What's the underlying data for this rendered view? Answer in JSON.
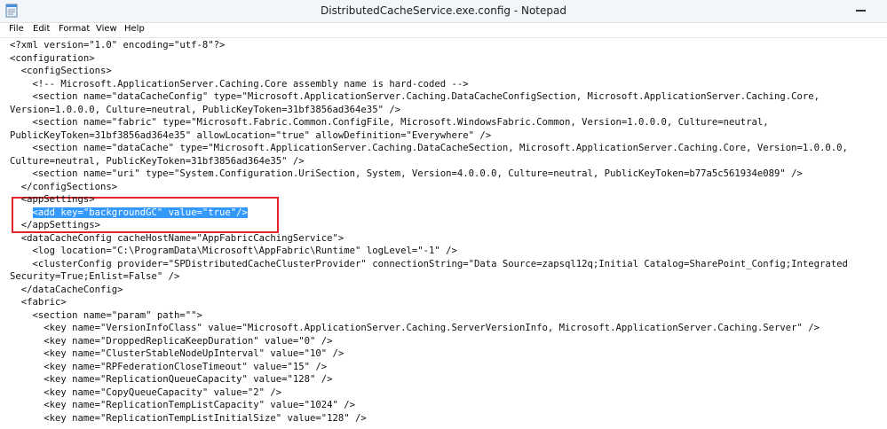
{
  "window": {
    "title": "DistributedCacheService.exe.config - Notepad"
  },
  "menu": [
    "File",
    "Edit",
    "Format",
    "View",
    "Help"
  ],
  "icons": {
    "app": "notepad-icon",
    "minimize": "minimize-icon"
  },
  "colors": {
    "selection": "#3399ff",
    "highlight_box": "#e3242b"
  },
  "editor": {
    "lines": [
      "<?xml version=\"1.0\" encoding=\"utf-8\"?>",
      "<configuration>",
      "  <configSections>",
      "    <!-- Microsoft.ApplicationServer.Caching.Core assembly name is hard-coded -->",
      "    <section name=\"dataCacheConfig\" type=\"Microsoft.ApplicationServer.Caching.DataCacheConfigSection, Microsoft.ApplicationServer.Caching.Core,",
      "Version=1.0.0.0, Culture=neutral, PublicKeyToken=31bf3856ad364e35\" />",
      "    <section name=\"fabric\" type=\"Microsoft.Fabric.Common.ConfigFile, Microsoft.WindowsFabric.Common, Version=1.0.0.0, Culture=neutral,",
      "PublicKeyToken=31bf3856ad364e35\" allowLocation=\"true\" allowDefinition=\"Everywhere\" />",
      "    <section name=\"dataCache\" type=\"Microsoft.ApplicationServer.Caching.DataCacheSection, Microsoft.ApplicationServer.Caching.Core, Version=1.0.0.0,",
      "Culture=neutral, PublicKeyToken=31bf3856ad364e35\" />",
      "    <section name=\"uri\" type=\"System.Configuration.UriSection, System, Version=4.0.0.0, Culture=neutral, PublicKeyToken=b77a5c561934e089\" />",
      "  </configSections>",
      "  <appSettings>",
      "    <add key=\"backgroundGC\" value=\"true\"/>",
      "  </appSettings>",
      "  <dataCacheConfig cacheHostName=\"AppFabricCachingService\">",
      "    <log location=\"C:\\ProgramData\\Microsoft\\AppFabric\\Runtime\" logLevel=\"-1\" />",
      "    <clusterConfig provider=\"SPDistributedCacheClusterProvider\" connectionString=\"Data Source=zapsql12q;Initial Catalog=SharePoint_Config;Integrated",
      "Security=True;Enlist=False\" />",
      "  </dataCacheConfig>",
      "  <fabric>",
      "    <section name=\"param\" path=\"\">",
      "      <key name=\"VersionInfoClass\" value=\"Microsoft.ApplicationServer.Caching.ServerVersionInfo, Microsoft.ApplicationServer.Caching.Server\" />",
      "      <key name=\"DroppedReplicaKeepDuration\" value=\"0\" />",
      "      <key name=\"ClusterStableNodeUpInterval\" value=\"10\" />",
      "      <key name=\"RPFederationCloseTimeout\" value=\"15\" />",
      "      <key name=\"ReplicationQueueCapacity\" value=\"128\" />",
      "      <key name=\"CopyQueueCapacity\" value=\"2\" />",
      "      <key name=\"ReplicationTempListCapacity\" value=\"1024\" />",
      "      <key name=\"ReplicationTempListInitialSize\" value=\"128\" />"
    ],
    "selected_line_index": 13
  }
}
